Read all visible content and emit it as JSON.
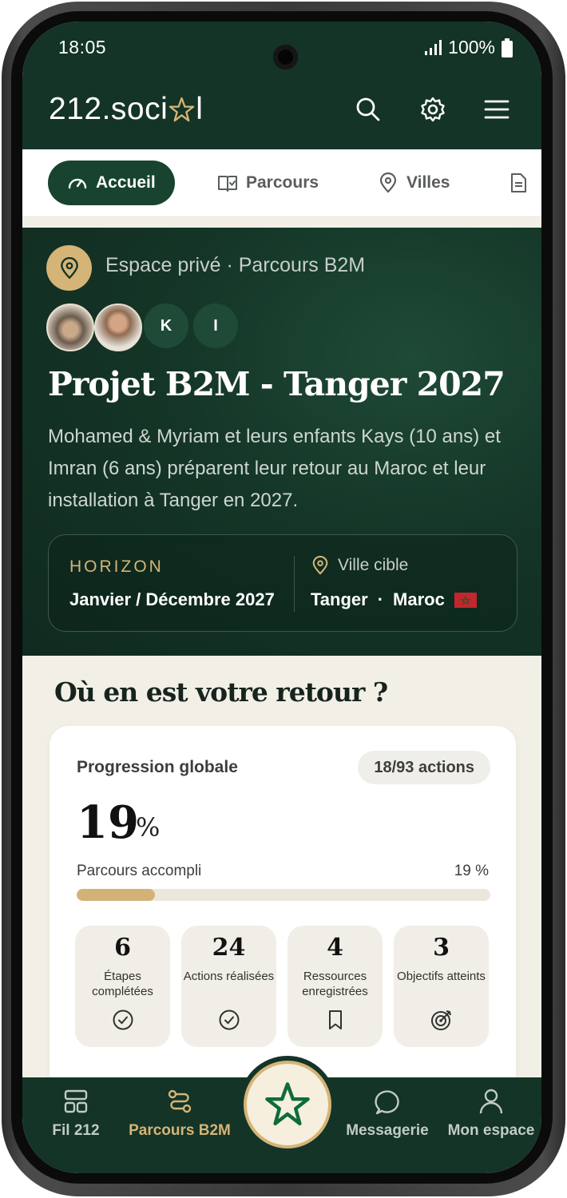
{
  "status_bar": {
    "time": "18:05",
    "battery": "100%"
  },
  "header": {
    "logo_pre": "212.soci",
    "logo_post": "l",
    "icons": [
      "search-icon",
      "gear-icon",
      "menu-icon"
    ]
  },
  "tabs": [
    {
      "label": "Accueil",
      "icon": "gauge-icon",
      "active": true
    },
    {
      "label": "Parcours",
      "icon": "book-check-icon"
    },
    {
      "label": "Villes",
      "icon": "pin-icon"
    },
    {
      "label": "",
      "icon": "document-icon"
    }
  ],
  "hero": {
    "breadcrumb": "Espace privé · Parcours B2M",
    "avatars": [
      "K",
      "I"
    ],
    "title": "Projet B2M - Tanger 2027",
    "description": "Mohamed & Myriam et leurs enfants Kays (10 ans) et Imran (6 ans) préparent leur retour au Maroc et leur installation à Tanger en 2027.",
    "horizon_label": "HORIZON",
    "horizon_value": "Janvier / Décembre 2027",
    "city_label": "Ville cible",
    "city_name": "Tanger",
    "city_sep": "·",
    "country": "Maroc"
  },
  "progress": {
    "section_title": "Où en est votre retour ?",
    "label": "Progression globale",
    "chip": "18/93 actions",
    "percent_value": "19",
    "percent_unit": "%",
    "bar_label": "Parcours accompli",
    "bar_percent": "19 %",
    "bar_fraction": 0.19,
    "stats": [
      {
        "value": "6",
        "label": "Étapes complétées",
        "icon": "check-circle-icon"
      },
      {
        "value": "24",
        "label": "Actions réalisées",
        "icon": "check-circle-icon"
      },
      {
        "value": "4",
        "label": "Ressources enregistrées",
        "icon": "bookmark-icon"
      },
      {
        "value": "3",
        "label": "Objectifs atteints",
        "icon": "target-icon"
      }
    ]
  },
  "bottom_nav": [
    {
      "label": "Fil 212",
      "icon": "grid-icon"
    },
    {
      "label": "Parcours B2M",
      "icon": "route-icon",
      "active": true
    },
    {
      "label": "Messagerie",
      "icon": "chat-icon"
    },
    {
      "label": "Mon espace",
      "icon": "user-icon"
    }
  ],
  "colors": {
    "primary": "#133426",
    "accent": "#d5b477",
    "flag_red": "#c1272d",
    "flag_green": "#006233"
  }
}
